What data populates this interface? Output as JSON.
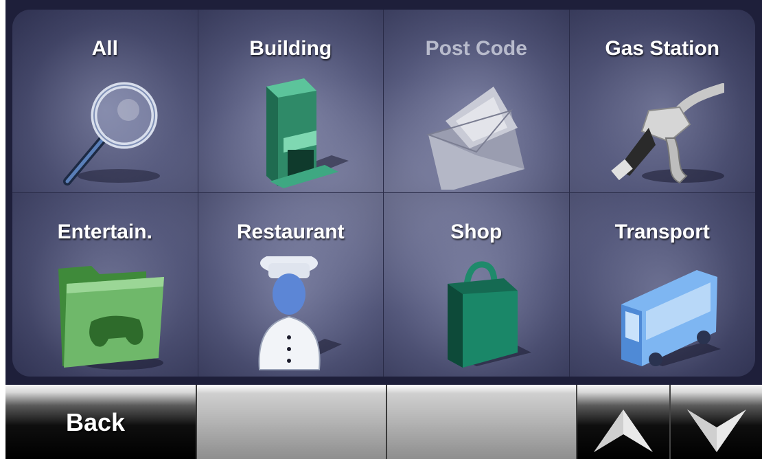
{
  "categories": [
    {
      "label": "All",
      "icon": "magnifying-glass-icon",
      "enabled": true
    },
    {
      "label": "Building",
      "icon": "building-icon",
      "enabled": true
    },
    {
      "label": "Post Code",
      "icon": "envelope-icon",
      "enabled": false
    },
    {
      "label": "Gas Station",
      "icon": "fuel-nozzle-icon",
      "enabled": true
    },
    {
      "label": "Entertain.",
      "icon": "game-folder-icon",
      "enabled": true
    },
    {
      "label": "Restaurant",
      "icon": "chef-icon",
      "enabled": true
    },
    {
      "label": "Shop",
      "icon": "shopping-bag-icon",
      "enabled": true
    },
    {
      "label": "Transport",
      "icon": "bus-icon",
      "enabled": true
    }
  ],
  "toolbar": {
    "back_label": "Back",
    "up_icon": "arrow-up-icon",
    "down_icon": "arrow-down-icon"
  },
  "colors": {
    "panel": "#5a5e82",
    "frame": "#1e1f3a",
    "label": "#ffffff",
    "label_disabled": "#b8bbcc"
  }
}
